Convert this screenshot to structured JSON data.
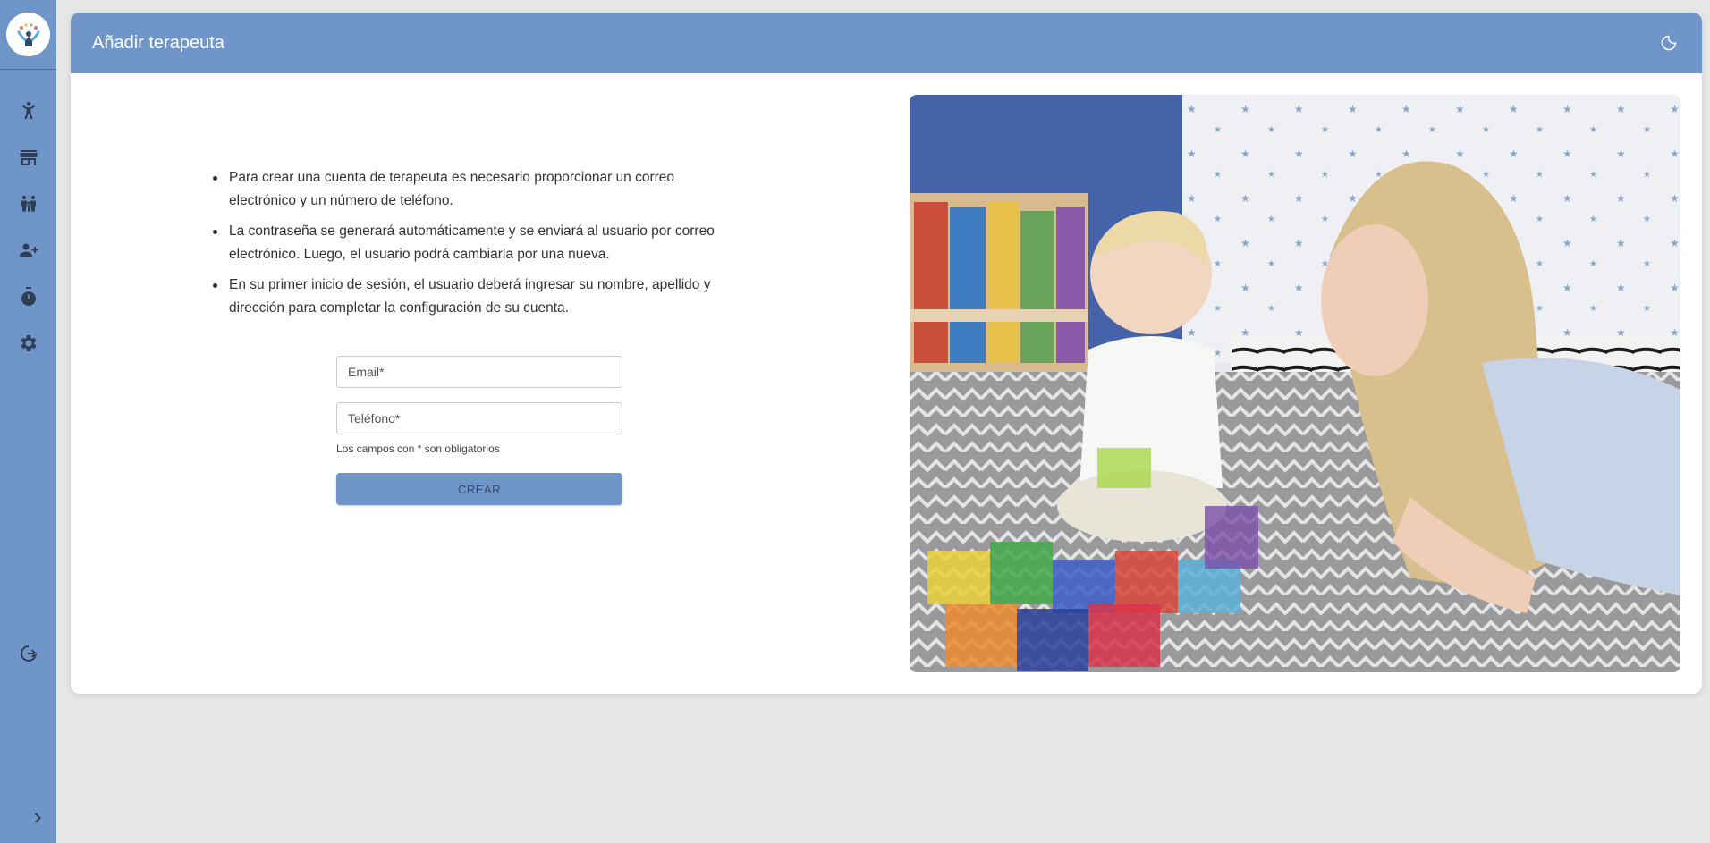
{
  "app": {
    "logo_icon": "therapy-logo-icon"
  },
  "sidebar": {
    "items": [
      {
        "icon": "child-icon",
        "name": "sidebar-item-patients"
      },
      {
        "icon": "store-icon",
        "name": "sidebar-item-centers"
      },
      {
        "icon": "family-icon",
        "name": "sidebar-item-families"
      },
      {
        "icon": "add-user-icon",
        "name": "sidebar-item-add-therapist"
      },
      {
        "icon": "timer-icon",
        "name": "sidebar-item-sessions"
      },
      {
        "icon": "gear-icon",
        "name": "sidebar-item-settings"
      }
    ],
    "logout_icon": "logout-icon",
    "collapse_icon": "chevron-right-icon"
  },
  "header": {
    "title": "Añadir terapeuta",
    "theme_icon": "moon-icon"
  },
  "info": {
    "items": [
      "Para crear una cuenta de terapeuta es necesario proporcionar un correo electrónico y un número de teléfono.",
      "La contraseña se generará automáticamente y se enviará al usuario por correo electrónico. Luego, el usuario podrá cambiarla por una nueva.",
      "En su primer inicio de sesión, el usuario deberá ingresar su nombre, apellido y dirección para completar la configuración de su cuenta."
    ]
  },
  "form": {
    "email_placeholder": "Email*",
    "email_value": "",
    "phone_placeholder": "Teléfono*",
    "phone_value": "",
    "required_hint": "Los campos con * son obligatorios",
    "submit_label": "CREAR"
  },
  "colors": {
    "primary": "#7096c9",
    "background": "#e7e7e7",
    "card": "#ffffff"
  }
}
